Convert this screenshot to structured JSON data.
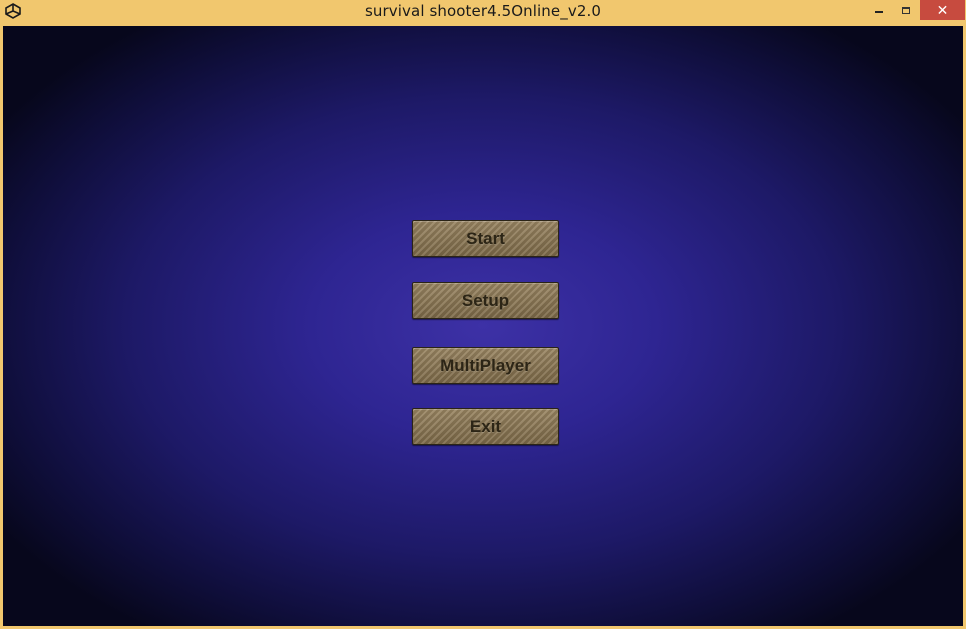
{
  "window": {
    "title": "survival shooter4.5Online_v2.0",
    "app_icon": "unity-logo-icon",
    "controls": {
      "minimize_icon": "minimize-icon",
      "maximize_icon": "maximize-icon",
      "close_label": "✕",
      "close_color": "#c74b3f"
    },
    "frame_color": "#f1c76e"
  },
  "menu": {
    "buttons": [
      {
        "label": "Start"
      },
      {
        "label": "Setup"
      },
      {
        "label": "MultiPlayer"
      },
      {
        "label": "Exit"
      }
    ]
  },
  "theme": {
    "background_center": "#3d31a6",
    "background_edge": "#07071c",
    "button_color": "#8c7855",
    "button_text_color": "#2c2516"
  }
}
